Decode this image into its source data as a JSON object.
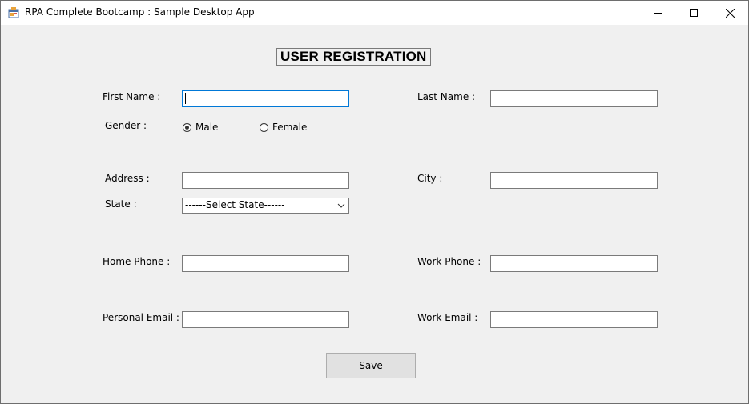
{
  "window": {
    "title": "RPA Complete Bootcamp : Sample Desktop App"
  },
  "form": {
    "heading": "USER REGISTRATION",
    "first_name_label": "First Name :",
    "last_name_label": "Last Name :",
    "gender_label": "Gender :",
    "gender_options": [
      "Male",
      "Female"
    ],
    "gender_selected": "Male",
    "address_label": "Address :",
    "city_label": "City :",
    "state_label": "State :",
    "state_select_value": "------Select State------",
    "home_phone_label": "Home Phone :",
    "work_phone_label": "Work Phone :",
    "personal_email_label": "Personal Email :",
    "work_email_label": "Work Email :",
    "save_label": "Save",
    "first_name_value": "",
    "last_name_value": "",
    "address_value": "",
    "city_value": "",
    "home_phone_value": "",
    "work_phone_value": "",
    "personal_email_value": "",
    "work_email_value": ""
  },
  "icons": {
    "app": "app-icon",
    "minimize": "minimize-icon",
    "maximize": "maximize-icon",
    "close": "close-icon",
    "dropdown": "chevron-down-icon"
  },
  "colors": {
    "window_bg": "#f0f0f0",
    "titlebar_bg": "#ffffff",
    "focus_border": "#0078d7",
    "field_border": "#7a7a7a",
    "button_bg": "#e1e1e1"
  }
}
